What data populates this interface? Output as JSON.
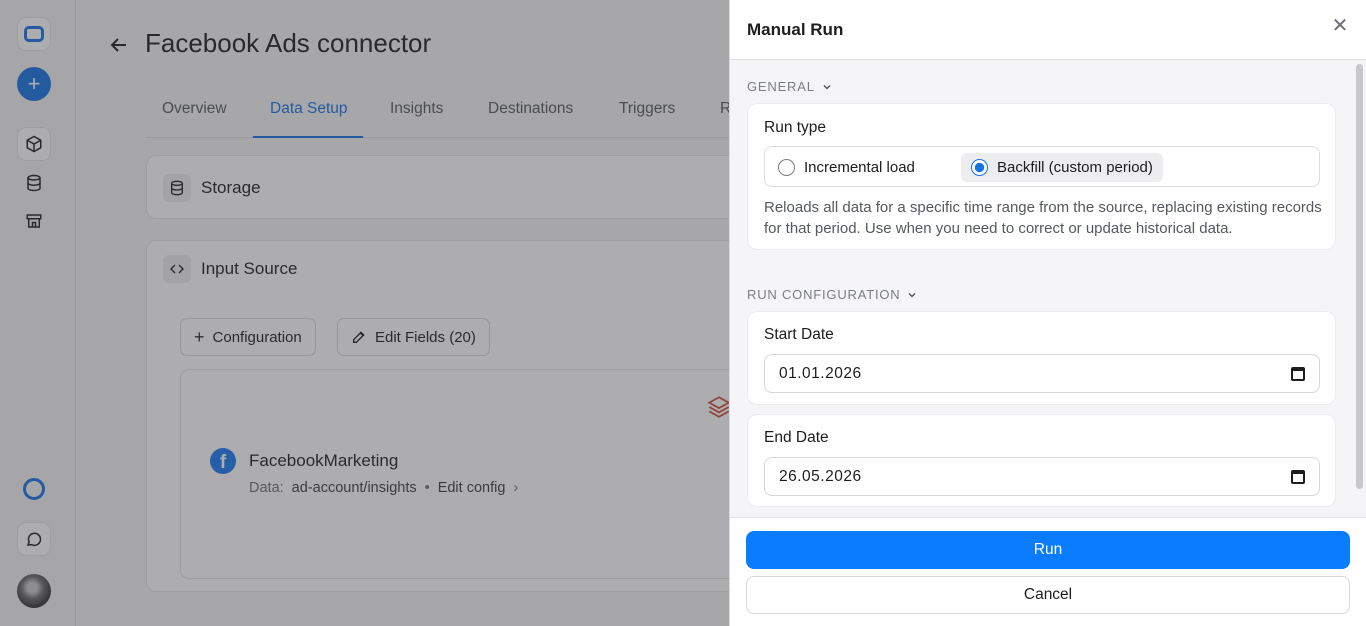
{
  "colors": {
    "accent": "#1473e6",
    "primary_button": "#0a7cff",
    "overlay": "rgba(60,60,64,0.42)"
  },
  "rail": {
    "icons": [
      "logo-icon",
      "plus-icon",
      "box-icon",
      "database-icon",
      "store-icon",
      "ring-icon",
      "chat-icon",
      "avatar"
    ]
  },
  "page": {
    "title": "Facebook Ads connector",
    "tabs": [
      "Overview",
      "Data Setup",
      "Insights",
      "Destinations",
      "Triggers",
      "R"
    ],
    "active_tab": "Data Setup"
  },
  "storage": {
    "title": "Storage"
  },
  "input_source": {
    "title": "Input Source",
    "configuration_button": "Configuration",
    "edit_fields_button": "Edit Fields (20)",
    "connector": {
      "name": "FacebookMarketing",
      "data_label": "Data:",
      "data_value": "ad-account/insights",
      "separator": "•",
      "edit_config": "Edit config"
    }
  },
  "panel": {
    "title": "Manual Run",
    "general_label": "GENERAL",
    "run_type": {
      "label": "Run type",
      "options": [
        "Incremental load",
        "Backfill (custom period)"
      ],
      "selected": "Backfill (custom period)",
      "description": "Reloads all data for a specific time range from the source, replacing existing records for that period. Use when you need to correct or update historical data."
    },
    "run_config_label": "RUN CONFIGURATION",
    "start_date": {
      "label": "Start Date",
      "value": "01.01.2026"
    },
    "end_date": {
      "label": "End Date",
      "value": "26.05.2026"
    },
    "run_button": "Run",
    "cancel_button": "Cancel"
  }
}
